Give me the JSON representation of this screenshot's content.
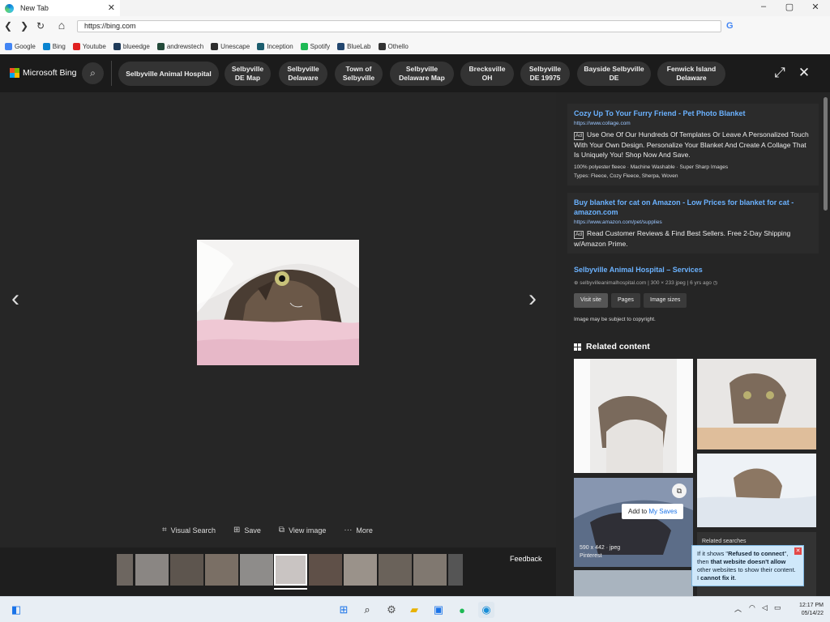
{
  "browser": {
    "tab_title": "New Tab",
    "tab_close": "✕",
    "url": "https://bing.com",
    "search_engine_icon": "G",
    "window_controls": [
      "–",
      "▢",
      "✕"
    ],
    "bookmarks": [
      {
        "label": "Google",
        "color": "#4285f4"
      },
      {
        "label": "Bing",
        "color": "#0a84d0"
      },
      {
        "label": "Youtube",
        "color": "#e02020"
      },
      {
        "label": "blueedge",
        "color": "#1f3b5a"
      },
      {
        "label": "andrewstech",
        "color": "#234a3a"
      },
      {
        "label": "Unescape",
        "color": "#2d2d2d"
      },
      {
        "label": "Inception",
        "color": "#1c5e6e"
      },
      {
        "label": "Spotify",
        "color": "#1db954"
      },
      {
        "label": "BlueLab",
        "color": "#22466e"
      },
      {
        "label": "Othello",
        "color": "#333333"
      }
    ]
  },
  "bing": {
    "logo_text": "Microsoft Bing",
    "chips": [
      {
        "label": "Selbyville Animal Hospital"
      },
      {
        "label": "Selbyville DE Map"
      },
      {
        "label": "Selbyville Delaware"
      },
      {
        "label": "Town of Selbyville"
      },
      {
        "label": "Selbyville Delaware Map"
      },
      {
        "label": "Brecksville OH"
      },
      {
        "label": "Selbyville DE 19975"
      },
      {
        "label": "Bayside Selbyville DE"
      },
      {
        "label": "Fenwick Island Delaware"
      }
    ],
    "viewer": {
      "prev": "‹",
      "next": "›",
      "actions": [
        {
          "label": "Visual Search",
          "icon": "⌗"
        },
        {
          "label": "Save",
          "icon": "⊞"
        },
        {
          "label": "View image",
          "icon": "⧉"
        },
        {
          "label": "More",
          "icon": "···"
        }
      ],
      "feedback": "Feedback"
    },
    "ads": [
      {
        "title": "Cozy Up To Your Furry Friend - Pet Photo Blanket",
        "url": "https://www.collage.com",
        "badge": "Ad",
        "desc": "Use One Of Our Hundreds Of Templates Or Leave A Personalized Touch With Your Own Design. Personalize Your Blanket And Create A Collage That Is Uniquely You! Shop Now And Save.",
        "meta1": "100% polyester fleece · Machine Washable · Super Sharp Images",
        "meta2": "Types: Fleece, Cozy Fleece, Sherpa, Woven"
      },
      {
        "title": "Buy blanket for cat on Amazon - Low Prices for blanket for cat - amazon.com",
        "url": "https://www.amazon.com/pet/supplies",
        "badge": "Ad",
        "desc": "Read Customer Reviews & Find Best Sellers. Free 2-Day Shipping w/Amazon Prime."
      }
    ],
    "source": {
      "title": "Selbyville Animal Hospital – Services",
      "domain": "selbyvilleanimalhospital.com",
      "dims": "300 × 233 jpeg",
      "age": "6 yrs ago",
      "buttons": [
        "Visit site",
        "Pages",
        "Image sizes"
      ],
      "copyright": "Image may be subject to copyright."
    },
    "related": {
      "title": "Related content",
      "tooltip_prefix": "Add to ",
      "tooltip_link": "My Saves",
      "thumb_meta_size": "590 x 442 · jpeg",
      "thumb_meta_source": "Pinterest",
      "related_searches": "Related searches"
    },
    "popup": {
      "line1": "If it shows \"",
      "bold1": "Refused to connect",
      "line2": "\", then ",
      "bold2": "that website doesn't allow",
      "line3": " other websites to show their content. I ",
      "bold3": "cannot fix it",
      "line4": "."
    }
  },
  "taskbar": {
    "time": "12:17 PM",
    "date": "05/14/22"
  }
}
